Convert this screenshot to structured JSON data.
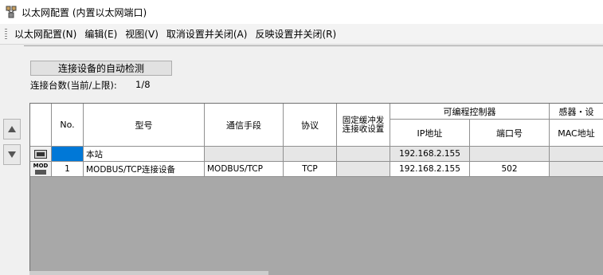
{
  "window": {
    "title": "以太网配置 (内置以太网端口)"
  },
  "menu": [
    "以太网配置(N)",
    "编辑(E)",
    "视图(V)",
    "取消设置并关闭(A)",
    "反映设置并关闭(R)"
  ],
  "toolbar": {
    "auto_detect_label": "连接设备的自动检测",
    "count_label": "连接台数(当前/上限):",
    "count_value": "1/8"
  },
  "table": {
    "headers": {
      "no": "No.",
      "model": "型号",
      "comm": "通信手段",
      "protocol": "协议",
      "fixed_buffer": "固定缓冲发\n连接收设置",
      "plc_group": "可编程控制器",
      "ip": "IP地址",
      "port": "端口号",
      "sensor_group": "感器・设",
      "mac": "MAC地址"
    },
    "rows": [
      {
        "icon": "station-icon",
        "no": "",
        "model": "本站",
        "comm": "",
        "protocol": "",
        "fixed_buffer": "",
        "ip": "192.168.2.155",
        "port": "",
        "mac": ""
      },
      {
        "icon": "mod",
        "icon_text": "MOD",
        "no": "1",
        "model": "MODBUS/TCP连接设备",
        "comm": "MODBUS/TCP",
        "protocol": "TCP",
        "fixed_buffer": "",
        "ip": "192.168.2.155",
        "port": "502",
        "mac": ""
      }
    ]
  },
  "colors": {
    "selection": "#0078d7",
    "empty_area": "#a8a8a8"
  }
}
